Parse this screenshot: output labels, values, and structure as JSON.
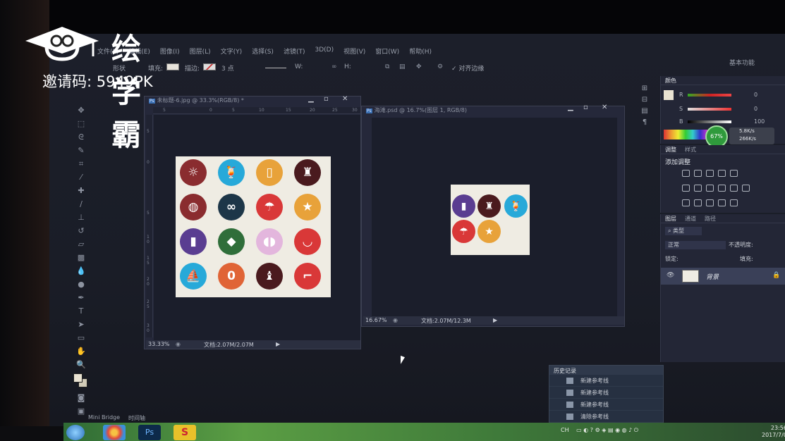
{
  "watermark": {
    "brand": "绘学霸",
    "invite": "邀请码: 5949PK"
  },
  "menu": [
    "文件(F)",
    "编辑(E)",
    "图像(I)",
    "图层(L)",
    "文字(Y)",
    "选择(S)",
    "滤镜(T)",
    "3D(D)",
    "视图(V)",
    "窗口(W)",
    "帮助(H)"
  ],
  "workspace": "基本功能",
  "options": {
    "shape_mode": "形状",
    "fill_label": "填充:",
    "stroke_label": "描边:",
    "stroke_size": "3 点",
    "w_label": "W:",
    "h_label": "H:",
    "align_edges": "对齐边缘"
  },
  "doc1": {
    "tab": "未标题-6.jpg @ 33.3%(RGB/8) *",
    "zoom": "33.33%",
    "doc_size": "文档:2.07M/2.07M",
    "ruler_h": [
      "5",
      "0",
      "5",
      "10",
      "15",
      "20",
      "25",
      "30"
    ],
    "ruler_v": [
      "5",
      "0",
      "5",
      "1 0",
      "1 5",
      "2 0",
      "2 5",
      "3 0"
    ]
  },
  "doc2": {
    "tab": "海滩.psd @ 16.7%(图层 1, RGB/8)",
    "zoom": "16.67%",
    "doc_size": "文档:2.07M/12.3M"
  },
  "icons_grid": [
    {
      "name": "sun-icon",
      "bg": "#8a2c2f",
      "glyph": "☼"
    },
    {
      "name": "cocktail-icon",
      "bg": "#27a9d9",
      "glyph": "🍹"
    },
    {
      "name": "sunscreen-icon",
      "bg": "#e8a23a",
      "glyph": "▯"
    },
    {
      "name": "sandcastle-icon",
      "bg": "#4a1a1e",
      "glyph": "♜"
    },
    {
      "name": "beach-ball-icon",
      "bg": "#8a2c2f",
      "glyph": "◍"
    },
    {
      "name": "sunglasses-icon",
      "bg": "#1d3648",
      "glyph": "∞"
    },
    {
      "name": "umbrella-icon",
      "bg": "#d93838",
      "glyph": "☂"
    },
    {
      "name": "starfish-icon",
      "bg": "#e8a23a",
      "glyph": "★"
    },
    {
      "name": "popsicle-icon",
      "bg": "#5a3d91",
      "glyph": "▮"
    },
    {
      "name": "pineapple-icon",
      "bg": "#2f6e3a",
      "glyph": "◆"
    },
    {
      "name": "flip-flops-icon",
      "bg": "#e3b6dd",
      "glyph": "◖◗"
    },
    {
      "name": "bikini-icon",
      "bg": "#d93838",
      "glyph": "◡"
    },
    {
      "name": "sailboat-icon",
      "bg": "#27a9d9",
      "glyph": "⛵"
    },
    {
      "name": "surfboard-icon",
      "bg": "#e06436",
      "glyph": "0"
    },
    {
      "name": "sand-bucket-icon",
      "bg": "#4a1a1e",
      "glyph": "♝"
    },
    {
      "name": "beach-chair-icon",
      "bg": "#d93838",
      "glyph": "⌐"
    }
  ],
  "icons_small": [
    {
      "name": "popsicle-icon",
      "bg": "#5a3d91",
      "glyph": "▮"
    },
    {
      "name": "sandcastle-icon",
      "bg": "#4a1a1e",
      "glyph": "♜"
    },
    {
      "name": "cocktail-icon",
      "bg": "#27a9d9",
      "glyph": "🍹"
    },
    {
      "name": "umbrella-icon",
      "bg": "#d93838",
      "glyph": "☂"
    },
    {
      "name": "starfish-icon",
      "bg": "#e8a23a",
      "glyph": "★"
    }
  ],
  "color_panel": {
    "tab": "颜色",
    "r": "0",
    "g": "0",
    "b": "100",
    "r_label": "R",
    "s_label": "S",
    "b_label": "B"
  },
  "net_meter": {
    "pct": "67%",
    "up": "5.8K/s",
    "down": "266K/s"
  },
  "adjust_panel": {
    "tab_adjust": "调整",
    "tab_style": "样式",
    "add_label": "添加调整"
  },
  "layers_panel": {
    "tabs": [
      "图层",
      "通道",
      "路径"
    ],
    "kind": "类型",
    "blend": "正常",
    "opacity_label": "不透明度:",
    "lock_label": "锁定:",
    "fill_label": "填充:",
    "layer_name": "背景"
  },
  "history": {
    "title": "历史记录",
    "items": [
      "新建参考线",
      "新建参考线",
      "新建参考线",
      "清除参考线"
    ]
  },
  "bottom_tabs": [
    "Mini Bridge",
    "时间轴"
  ],
  "tray": {
    "lang": "CH"
  },
  "clock": {
    "time": "23:56",
    "date": "2017/7/0"
  }
}
